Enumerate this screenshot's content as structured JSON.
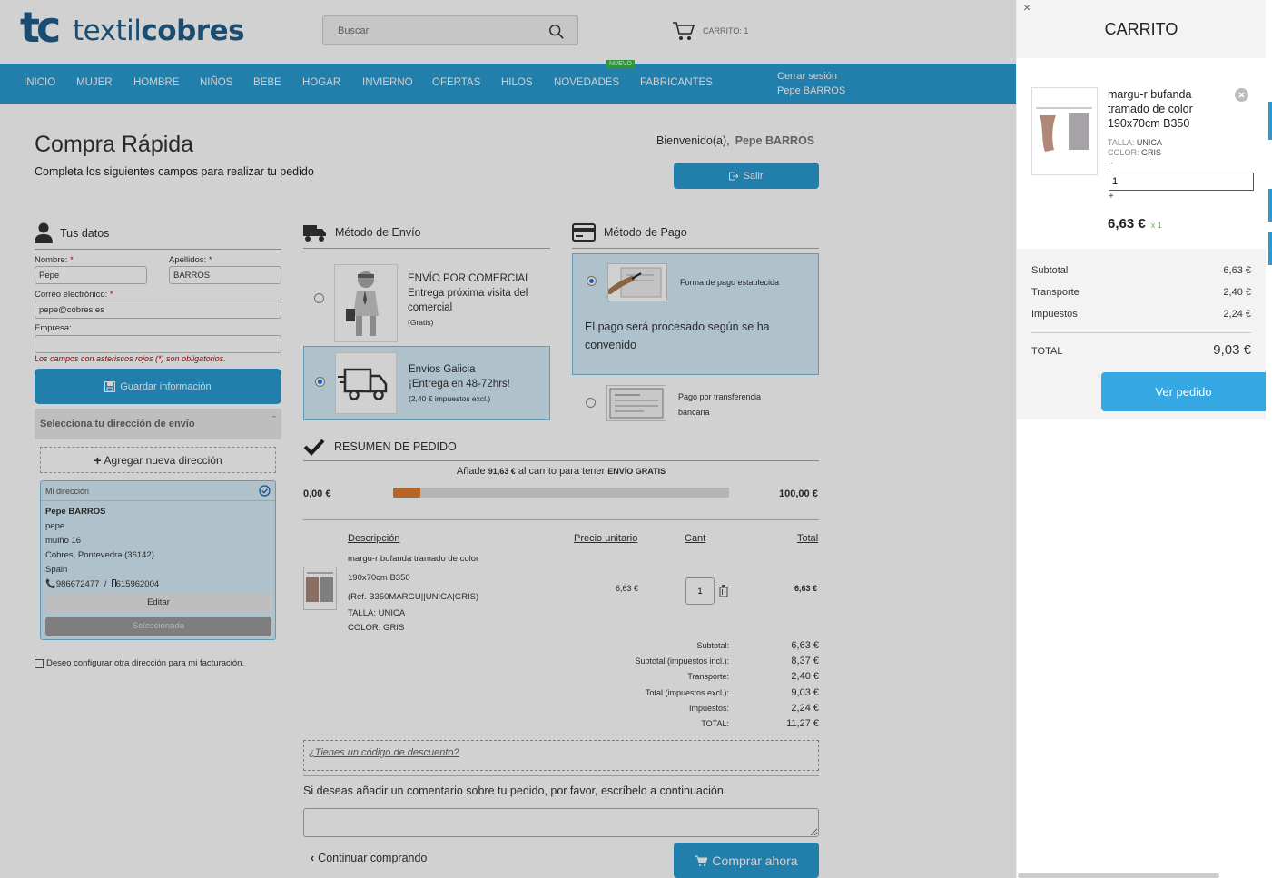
{
  "header": {
    "logo_mark": "tc",
    "logo_text_1": "textil",
    "logo_text_2": "cobres",
    "search_placeholder": "Buscar",
    "cart_label": "CARRITO: 1"
  },
  "nav": {
    "items": [
      "INICIO",
      "MUJER",
      "HOMBRE",
      "NIÑOS",
      "BEBE",
      "HOGAR",
      "INVIERNO",
      "OFERTAS",
      "HILOS",
      "NOVEDADES",
      "FABRICANTES"
    ],
    "badge": "NUEVO",
    "logout": "Cerrar sesión",
    "user": "Pepe BARROS"
  },
  "page": {
    "title": "Compra Rápida",
    "subtitle": "Completa los siguientes campos para realizar tu pedido",
    "welcome": "Bienvenido(a),",
    "welcome_name": "Pepe BARROS",
    "salir": "Salir"
  },
  "datos": {
    "heading": "Tus datos",
    "nombre_label": "Nombre:",
    "nombre_value": "Pepe",
    "apellidos_label": "Apellidos:",
    "apellidos_value": "BARROS",
    "email_label": "Correo electrónico:",
    "email_value": "pepe@cobres.es",
    "empresa_label": "Empresa:",
    "empresa_value": "",
    "required_note": "Los campos con asteriscos rojos (*) son obligatorios.",
    "save_button": "Guardar información",
    "address_selector": "Selecciona tu dirección de envío",
    "add_address": "Agregar nueva dirección",
    "address": {
      "alias": "Mi dirección",
      "name": "Pepe BARROS",
      "company": "pepe",
      "street": "muiño 16",
      "city": "Cobres, Pontevedra (36142)",
      "country": "Spain",
      "phone": "986672477",
      "sep": "/",
      "mobile": "615962004",
      "edit": "Editar",
      "selected": "Seleccionada"
    },
    "billing_checkbox": "Deseo configurar otra dirección para mi facturación."
  },
  "envio": {
    "heading": "Método de Envío",
    "options": [
      {
        "line1": "ENVÍO POR COMERCIAL",
        "line2": "Entrega próxima visita del",
        "line3": "comercial",
        "note": "(Gratis)"
      },
      {
        "line1": "Envíos Galicia",
        "line2": "¡Entrega en 48-72hrs!",
        "note": "(2,40 € impuestos excl.)"
      }
    ]
  },
  "pago": {
    "heading": "Método de Pago",
    "opt1_label": "Forma de pago establecida",
    "opt1_desc_1": "El pago será procesado según se ha",
    "opt1_desc_2": "convenido",
    "opt2_label_1": "Pago por transferencia",
    "opt2_label_2": "bancaria"
  },
  "resumen": {
    "heading": "RESUMEN DE PEDIDO",
    "promo_pre": "Añade",
    "promo_amount": "91,63 €",
    "promo_mid": "al carrito para tener",
    "promo_bold": "ENVÍO GRATIS",
    "progress_min": "0,00 €",
    "progress_max": "100,00 €",
    "progress_fraction": 0.08,
    "cols": {
      "desc": "Descripción",
      "unit": "Precio unitario",
      "qty": "Cant",
      "total": "Total"
    },
    "item": {
      "name_1": "margu-r bufanda tramado de color",
      "name_2": "190x70cm B350",
      "ref": "(Ref. B350MARGU||UNICA|GRIS)",
      "talla": "TALLA: UNICA",
      "color": "COLOR: GRIS",
      "unit_price": "6,63 €",
      "qty": "1",
      "total": "6,63 €"
    },
    "totals": [
      {
        "label": "Subtotal:",
        "value": "6,63 €"
      },
      {
        "label": "Subtotal (impuestos incl.):",
        "value": "8,37 €"
      },
      {
        "label": "Transporte:",
        "value": "2,40 €"
      },
      {
        "label": "Total (impuestos excl.):",
        "value": "9,03 €"
      },
      {
        "label": "Impuestos:",
        "value": "2,24 €"
      },
      {
        "label": "TOTAL:",
        "value": "11,27 €"
      }
    ],
    "discount": "¿Tienes un código de descuento?",
    "comment_label": "Si deseas añadir un comentario sobre tu pedido, por favor, escríbelo a continuación.",
    "continue": "Continuar comprando",
    "buy": "Comprar ahora"
  },
  "sidecart": {
    "close": "×",
    "title": "CARRITO",
    "product_1": "margu-r bufanda",
    "product_2": "tramado de color",
    "product_3": "190x70cm B350",
    "talla_label": "TALLA:",
    "talla_value": "UNICA",
    "color_label": "COLOR:",
    "color_value": "GRIS",
    "minus": "–",
    "qty": "1",
    "plus": "+",
    "price": "6,63 €",
    "qty_note": "x 1",
    "rows": [
      {
        "label": "Subtotal",
        "value": "6,63 €"
      },
      {
        "label": "Transporte",
        "value": "2,40 €"
      },
      {
        "label": "Impuestos",
        "value": "2,24 €"
      }
    ],
    "total_label": "TOTAL",
    "total_value": "9,03 €",
    "view_order": "Ver pedido"
  },
  "colors": {
    "brand": "#2a9ad0",
    "logo": "#1f5e8a",
    "badge": "#3fb34f",
    "progress": "#e07a2f"
  }
}
